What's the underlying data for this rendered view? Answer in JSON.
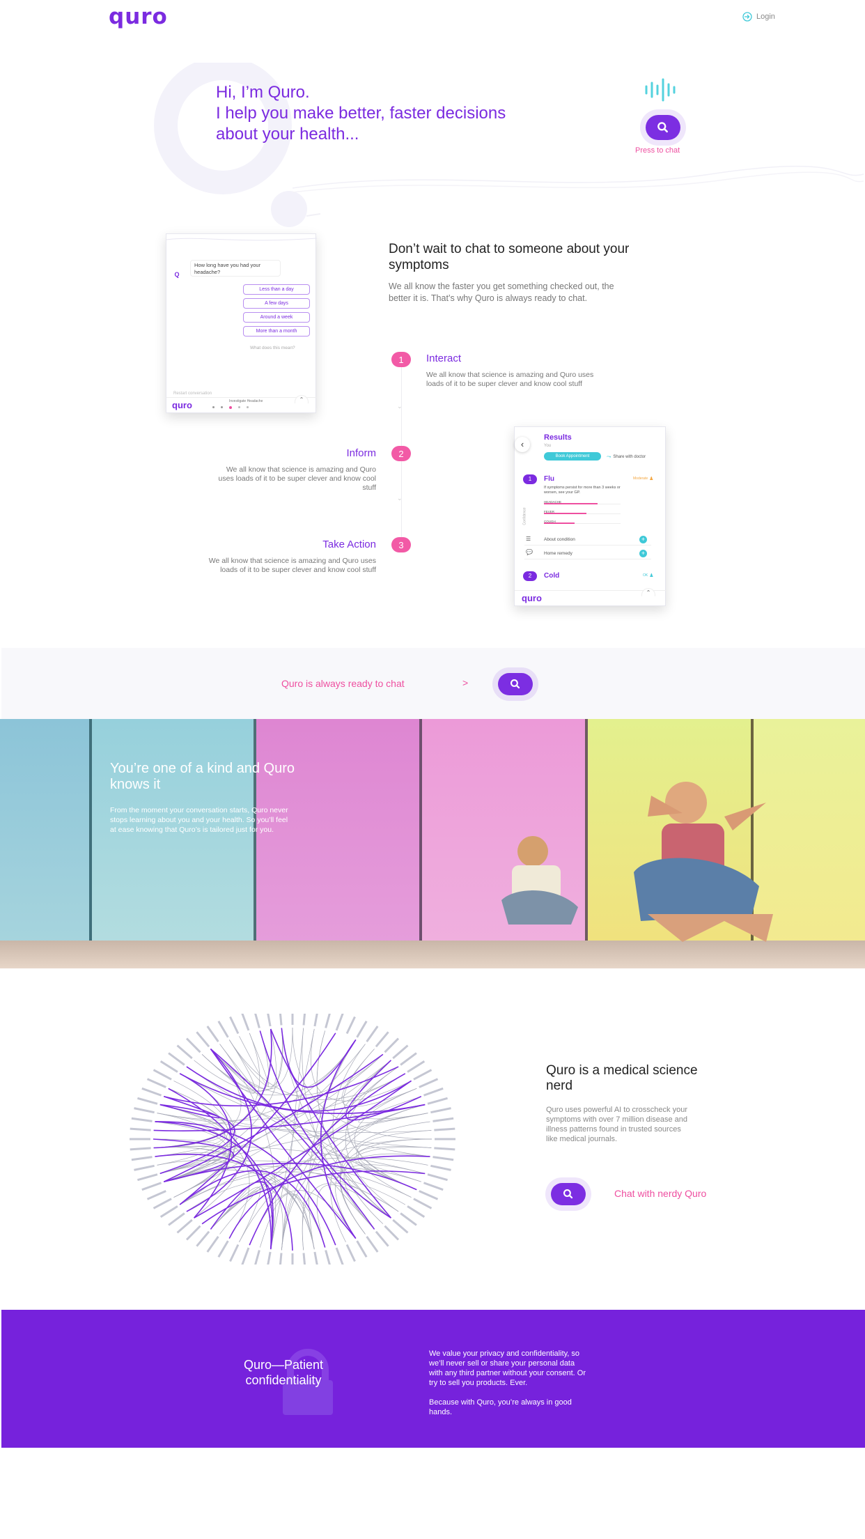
{
  "brand": {
    "logo": "quro",
    "login": "Login",
    "colors": {
      "accent": "#7b2be0",
      "pink": "#ee4fa0",
      "teal": "#3fc9d8"
    }
  },
  "hero": {
    "line1": "Hi, I’m Quro.",
    "line2": "I help you make better, faster decisions",
    "line3": "about your health...",
    "press": "Press to chat"
  },
  "chat_mock": {
    "question": "How long have you had your headache?",
    "options": [
      "Less than a day",
      "A few days",
      "Around a week",
      "More than a month"
    ],
    "why": "What does this mean?",
    "restart": "Restart conversation",
    "logo": "quro",
    "footer_label": "Investigate Headache"
  },
  "intro": {
    "title_line1": "Don’t wait to chat to someone about your",
    "title_line2": "symptoms",
    "body_line1": "We all know the faster you get something checked out, the",
    "body_line2": "better it is. That’s why Quro is always ready to chat."
  },
  "steps": [
    {
      "num": "1",
      "title": "Interact",
      "body_line1": "We all know that science is amazing and Quro uses",
      "body_line2": "loads of it to be super clever and know cool stuff"
    },
    {
      "num": "2",
      "title": "Inform",
      "body_line1": "We all know that science is amazing and Quro",
      "body_line2": "uses loads of it to be super clever and know cool",
      "body_line3": "stuff"
    },
    {
      "num": "3",
      "title": "Take Action",
      "body_line1": "We all know that science is amazing and Quro uses",
      "body_line2": "loads of it to be super clever and know cool stuff"
    }
  ],
  "results_mock": {
    "title": "Results",
    "you": "You",
    "book": "Book Appointment",
    "share": "Share with doctor",
    "flu": {
      "num": "1",
      "name": "Flu",
      "badge": "Moderate",
      "note_line1": "If symptoms persist for more than 3 weeks or",
      "note_line2": "worsen, see your GP.",
      "side": "Confidence",
      "symptoms": [
        "HEADACHE",
        "FEVER",
        "COUGH"
      ],
      "symptom_levels": [
        0.7,
        0.55,
        0.4
      ]
    },
    "rows": [
      "About condition",
      "Home remedy"
    ],
    "cold": {
      "num": "2",
      "name": "Cold",
      "badge": "OK"
    },
    "logo": "quro"
  },
  "cta_band": {
    "text": "Quro is always ready to chat",
    "arrow": ">"
  },
  "kind": {
    "title_line1": "You’re one of a kind and Quro",
    "title_line2": "knows it",
    "body_line1": "From the moment your conversation starts, Quro never",
    "body_line2": "stops learning about you and your health. So you’ll feel",
    "body_line3": "at ease knowing that Quro’s is tailored just for you."
  },
  "nerd": {
    "title_line1": "Quro is a medical science",
    "title_line2": "nerd",
    "body_line1": "Quro uses powerful AI to crosscheck your",
    "body_line2": "symptoms with over 7 million disease and",
    "body_line3": "illness patterns found in trusted sources",
    "body_line4": "like medical journals.",
    "cta": "Chat with nerdy Quro"
  },
  "privacy": {
    "title_line1": "Quro—Patient",
    "title_line2": "confidentiality",
    "body_line1": "We value your privacy and confidentiality, so",
    "body_line2": "we’ll never sell or share your personal data",
    "body_line3": "with any third partner without your consent. Or",
    "body_line4": "try to sell you products. Ever.",
    "body_line5": "Because with Quro, you’re always in good",
    "body_line6": "hands."
  }
}
